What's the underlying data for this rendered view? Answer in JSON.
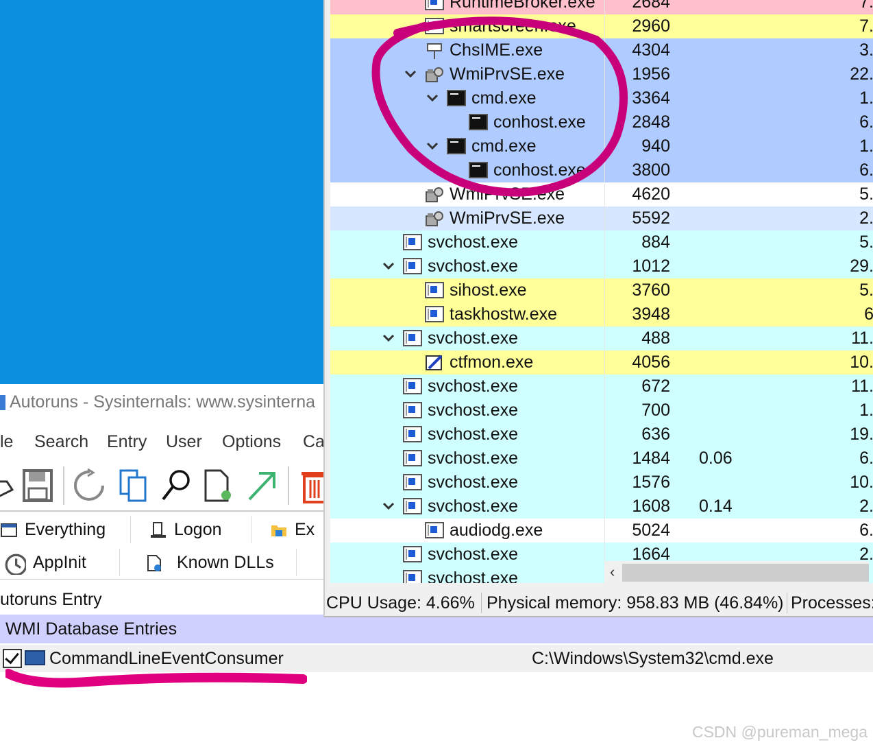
{
  "autoruns": {
    "title": "Autoruns - Sysinternals: www.sysinterna",
    "menu": [
      "le",
      "Search",
      "Entry",
      "User",
      "Options",
      "Ca"
    ],
    "toolbar_icons": [
      "open-icon",
      "save-icon",
      "refresh-icon",
      "copy-icon",
      "find-icon",
      "properties-icon",
      "jump-icon",
      "delete-icon"
    ],
    "tabs_row1": [
      {
        "label": "Everything",
        "icon": "everything-icon"
      },
      {
        "label": "Logon",
        "icon": "logon-icon"
      },
      {
        "label": "Ex",
        "icon": "folder-icon"
      }
    ],
    "tabs_row2": [
      {
        "label": "AppInit",
        "icon": "appinit-icon"
      },
      {
        "label": "Known DLLs",
        "icon": "knowndlls-icon"
      }
    ],
    "column_header": "utoruns Entry",
    "group": "WMI Database Entries",
    "entry": {
      "name": "CommandLineEventConsumer",
      "path": "C:\\Windows\\System32\\cmd.exe",
      "checked": true
    }
  },
  "procexp": {
    "rows": [
      {
        "name": "RuntimeBroker.exe",
        "pid": "2684",
        "cpu": "",
        "mem": "7.",
        "indent": 2,
        "icon": "service-icon",
        "bg": "#ffc0cb",
        "expander": false
      },
      {
        "name": "smartscreen.exe",
        "pid": "2960",
        "cpu": "",
        "mem": "7.",
        "indent": 2,
        "icon": "service-icon",
        "bg": "#ffff99",
        "expander": false
      },
      {
        "name": "ChsIME.exe",
        "pid": "4304",
        "cpu": "",
        "mem": "3.",
        "indent": 2,
        "icon": "ime-icon",
        "bg": "#b0cbff",
        "expander": false
      },
      {
        "name": "WmiPrvSE.exe",
        "pid": "1956",
        "cpu": "",
        "mem": "22.",
        "indent": 2,
        "icon": "wmi-icon",
        "bg": "#b0cbff",
        "expander": true
      },
      {
        "name": "cmd.exe",
        "pid": "3364",
        "cpu": "",
        "mem": "1.",
        "indent": 3,
        "icon": "console-icon",
        "bg": "#b0cbff",
        "expander": true
      },
      {
        "name": "conhost.exe",
        "pid": "2848",
        "cpu": "",
        "mem": "6.",
        "indent": 4,
        "icon": "console-icon",
        "bg": "#b0cbff",
        "expander": false
      },
      {
        "name": "cmd.exe",
        "pid": "940",
        "cpu": "",
        "mem": "1.",
        "indent": 3,
        "icon": "console-icon",
        "bg": "#b0cbff",
        "expander": true
      },
      {
        "name": "conhost.exe",
        "pid": "3800",
        "cpu": "",
        "mem": "6.",
        "indent": 4,
        "icon": "console-icon",
        "bg": "#b0cbff",
        "expander": false
      },
      {
        "name": "WmiPrvSE.exe",
        "pid": "4620",
        "cpu": "",
        "mem": "5.",
        "indent": 2,
        "icon": "wmi-icon",
        "bg": "#ffffff",
        "expander": false
      },
      {
        "name": "WmiPrvSE.exe",
        "pid": "5592",
        "cpu": "",
        "mem": "2.",
        "indent": 2,
        "icon": "wmi-icon",
        "bg": "#d6e7ff",
        "expander": false
      },
      {
        "name": "svchost.exe",
        "pid": "884",
        "cpu": "",
        "mem": "5.",
        "indent": 1,
        "icon": "service-icon",
        "bg": "#d0ffff",
        "expander": false
      },
      {
        "name": "svchost.exe",
        "pid": "1012",
        "cpu": "",
        "mem": "29.",
        "indent": 1,
        "icon": "service-icon",
        "bg": "#d0ffff",
        "expander": true
      },
      {
        "name": "sihost.exe",
        "pid": "3760",
        "cpu": "",
        "mem": "5.",
        "indent": 2,
        "icon": "service-icon",
        "bg": "#ffff99",
        "expander": false
      },
      {
        "name": "taskhostw.exe",
        "pid": "3948",
        "cpu": "",
        "mem": "6",
        "indent": 2,
        "icon": "service-icon",
        "bg": "#ffff99",
        "expander": false
      },
      {
        "name": "svchost.exe",
        "pid": "488",
        "cpu": "",
        "mem": "11.",
        "indent": 1,
        "icon": "service-icon",
        "bg": "#d0ffff",
        "expander": true
      },
      {
        "name": "ctfmon.exe",
        "pid": "4056",
        "cpu": "",
        "mem": "10.",
        "indent": 2,
        "icon": "ctfmon-icon",
        "bg": "#ffff99",
        "expander": false
      },
      {
        "name": "svchost.exe",
        "pid": "672",
        "cpu": "",
        "mem": "11.",
        "indent": 1,
        "icon": "service-icon",
        "bg": "#d0ffff",
        "expander": false
      },
      {
        "name": "svchost.exe",
        "pid": "700",
        "cpu": "",
        "mem": "1.",
        "indent": 1,
        "icon": "service-icon",
        "bg": "#d0ffff",
        "expander": false
      },
      {
        "name": "svchost.exe",
        "pid": "636",
        "cpu": "",
        "mem": "19.",
        "indent": 1,
        "icon": "service-icon",
        "bg": "#d0ffff",
        "expander": false
      },
      {
        "name": "svchost.exe",
        "pid": "1484",
        "cpu": "0.06",
        "mem": "6.",
        "indent": 1,
        "icon": "service-icon",
        "bg": "#d0ffff",
        "expander": false
      },
      {
        "name": "svchost.exe",
        "pid": "1576",
        "cpu": "",
        "mem": "10.",
        "indent": 1,
        "icon": "service-icon",
        "bg": "#d0ffff",
        "expander": false
      },
      {
        "name": "svchost.exe",
        "pid": "1608",
        "cpu": "0.14",
        "mem": "2.",
        "indent": 1,
        "icon": "service-icon",
        "bg": "#d0ffff",
        "expander": true
      },
      {
        "name": "audiodg.exe",
        "pid": "5024",
        "cpu": "",
        "mem": "6.",
        "indent": 2,
        "icon": "service-icon",
        "bg": "#ffffff",
        "expander": false
      },
      {
        "name": "svchost.exe",
        "pid": "1664",
        "cpu": "",
        "mem": "2.",
        "indent": 1,
        "icon": "service-icon",
        "bg": "#d0ffff",
        "expander": false
      },
      {
        "name": "svchost.exe",
        "pid": "",
        "cpu": "",
        "mem": "",
        "indent": 1,
        "icon": "service-icon",
        "bg": "#d0ffff",
        "expander": false
      }
    ],
    "status": {
      "cpu": "CPU Usage: 4.66%",
      "memory": "Physical memory: 958.83 MB (46.84%)",
      "processes": "Processes:"
    }
  },
  "annotation_color": "#e0007f",
  "watermark": "CSDN @pureman_mega"
}
